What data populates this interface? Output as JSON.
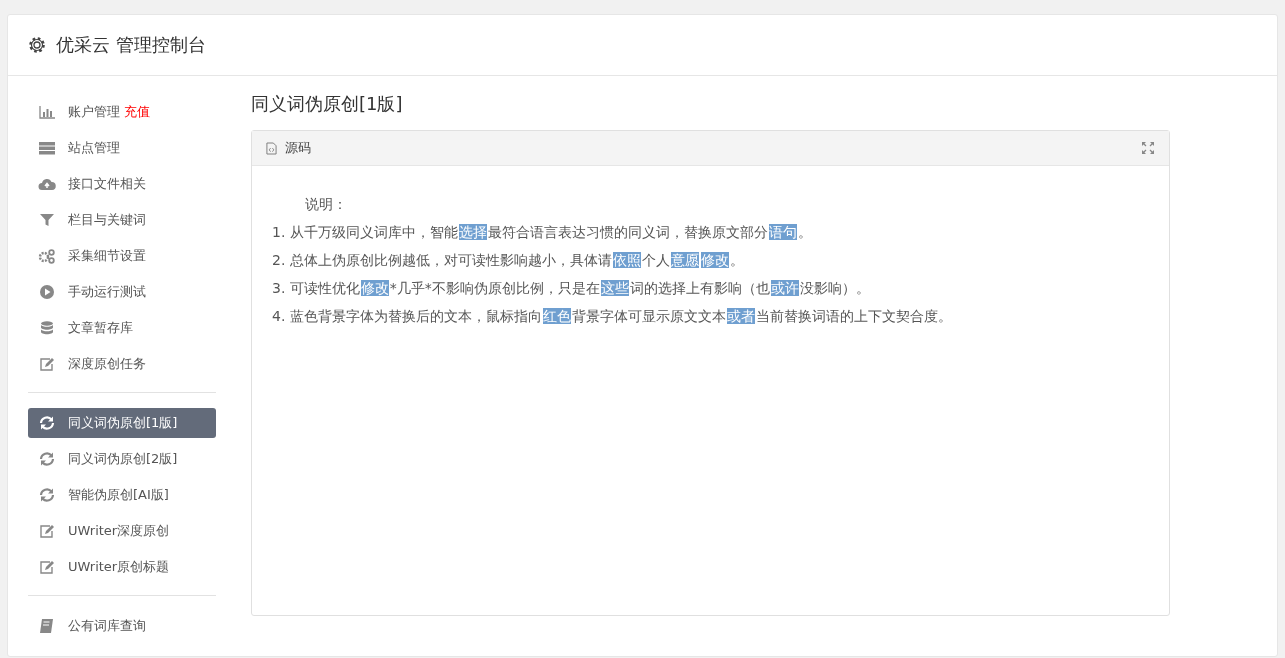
{
  "header": {
    "title": "优采云 管理控制台"
  },
  "sidebar": {
    "groups": [
      {
        "items": [
          {
            "label": "账户管理",
            "badge": "充值",
            "kind": "chart",
            "selected": false
          },
          {
            "label": "站点管理",
            "kind": "server",
            "selected": false
          },
          {
            "label": "接口文件相关",
            "kind": "cloud",
            "selected": false
          },
          {
            "label": "栏目与关键词",
            "kind": "filter",
            "selected": false
          },
          {
            "label": "采集细节设置",
            "kind": "gears",
            "selected": false
          },
          {
            "label": "手动运行测试",
            "kind": "play",
            "selected": false
          },
          {
            "label": "文章暂存库",
            "kind": "database",
            "selected": false
          },
          {
            "label": "深度原创任务",
            "kind": "edit",
            "selected": false
          }
        ]
      },
      {
        "items": [
          {
            "label": "同义词伪原创[1版]",
            "kind": "refresh",
            "selected": true
          },
          {
            "label": "同义词伪原创[2版]",
            "kind": "refresh",
            "selected": false
          },
          {
            "label": "智能伪原创[AI版]",
            "kind": "refresh",
            "selected": false
          },
          {
            "label": "UWriter深度原创",
            "kind": "edit",
            "selected": false
          },
          {
            "label": "UWriter原创标题",
            "kind": "edit",
            "selected": false
          }
        ]
      },
      {
        "items": [
          {
            "label": "公有词库查询",
            "kind": "book",
            "selected": false
          }
        ]
      }
    ]
  },
  "main": {
    "title": "同义词伪原创[1版]",
    "panel": {
      "tab": "源码",
      "heading": "说明：",
      "lines": [
        [
          {
            "text": "1. 从千万级同义词库中，智能",
            "highlighted": false
          },
          {
            "text": "选择",
            "highlighted": true
          },
          {
            "text": "最符合语言表达习惯的同义词，替换原文部分",
            "highlighted": false
          },
          {
            "text": "语句",
            "highlighted": true
          },
          {
            "text": "。",
            "highlighted": false
          }
        ],
        [
          {
            "text": "2. 总体上伪原创比例越低，对可读性影响越小，具体请",
            "highlighted": false
          },
          {
            "text": "依照",
            "highlighted": true
          },
          {
            "text": "个人",
            "highlighted": false
          },
          {
            "text": "意愿",
            "highlighted": true
          },
          {
            "text": "修改",
            "highlighted": true
          },
          {
            "text": "。",
            "highlighted": false
          }
        ],
        [
          {
            "text": "3. 可读性优化",
            "highlighted": false
          },
          {
            "text": "修改",
            "highlighted": true
          },
          {
            "text": "*几乎*不影响伪原创比例，只是在",
            "highlighted": false
          },
          {
            "text": "这些",
            "highlighted": true
          },
          {
            "text": "词的选择上有影响（也",
            "highlighted": false
          },
          {
            "text": "或许",
            "highlighted": true
          },
          {
            "text": "没影响）。",
            "highlighted": false
          }
        ],
        [
          {
            "text": "4. 蓝色背景字体为替换后的文本，鼠标指向",
            "highlighted": false
          },
          {
            "text": "红色",
            "highlighted": true
          },
          {
            "text": "背景字体可显示原文文本",
            "highlighted": false
          },
          {
            "text": "或者",
            "highlighted": true
          },
          {
            "text": "当前替换词语的上下文契合度。",
            "highlighted": false
          }
        ]
      ]
    }
  }
}
